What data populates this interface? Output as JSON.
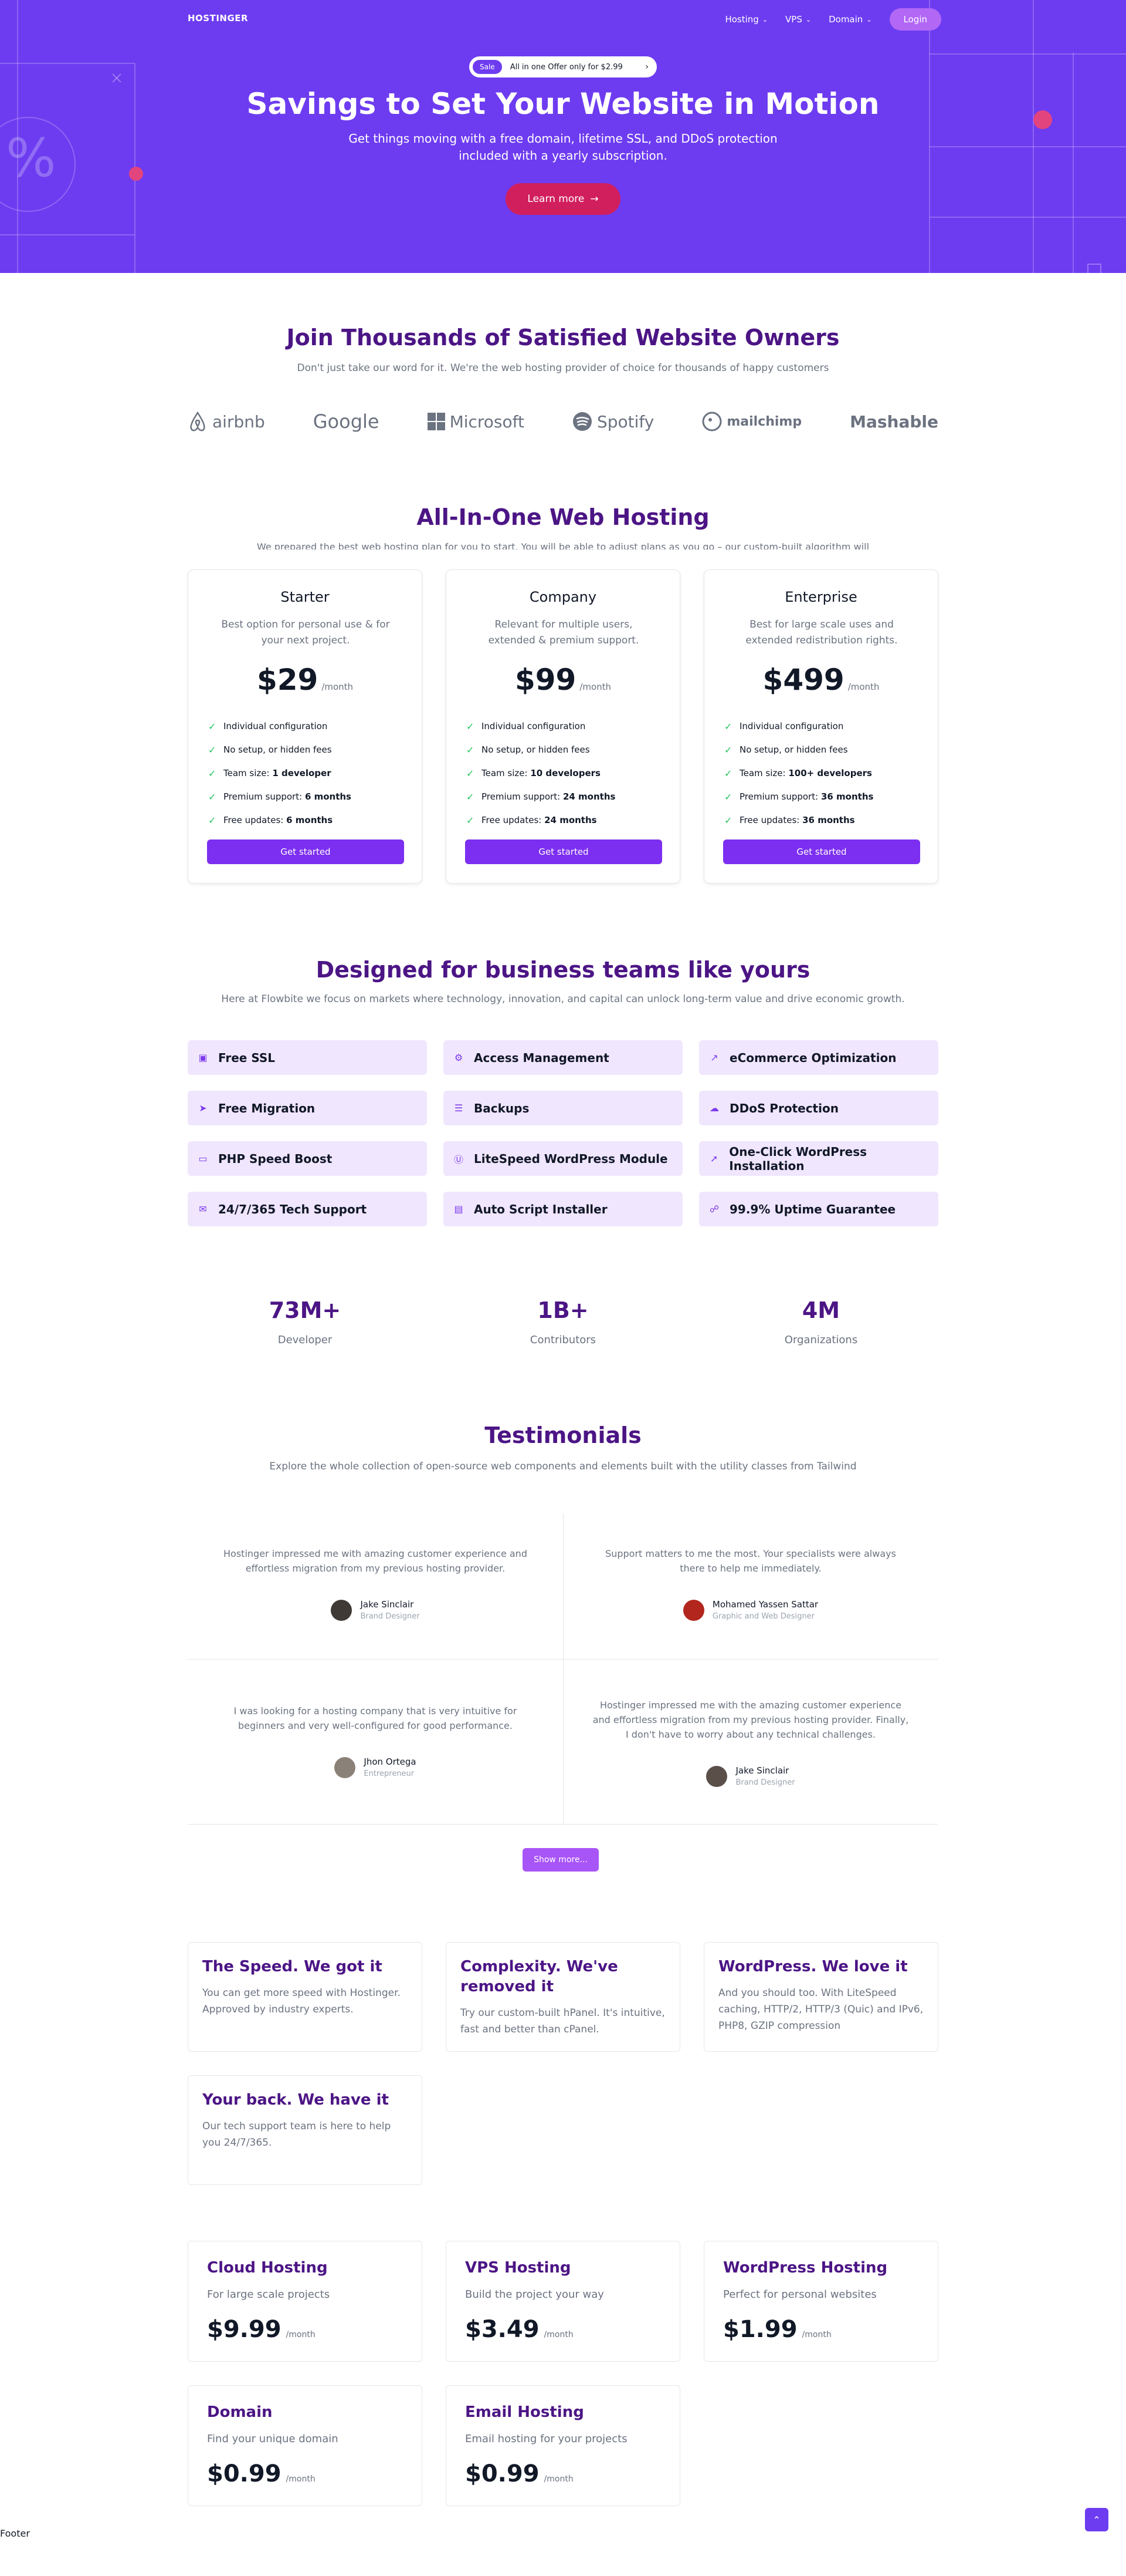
{
  "nav": {
    "logo": "HOSTINGER",
    "items": [
      {
        "label": "Hosting"
      },
      {
        "label": "VPS"
      },
      {
        "label": "Domain"
      }
    ],
    "login": "Login"
  },
  "hero": {
    "offer_badge": "Sale",
    "offer_text": "All in one Offer only for $2.99",
    "title": "Savings to Set Your Website in Motion",
    "subtitle": "Get things moving with a free domain, lifetime SSL, and DDoS protection included with a yearly subscription.",
    "cta": "Learn more",
    "colors": {
      "background": "#6d3cf0",
      "cta": "#d11f5e"
    }
  },
  "clients": {
    "title": "Join Thousands of Satisfied Website Owners",
    "subtitle": "Don't just take our word for it. We're the web hosting provider of choice for thousands of happy customers",
    "logos": [
      {
        "name": "airbnb",
        "icon": "airbnb-icon"
      },
      {
        "name": "Google",
        "icon": ""
      },
      {
        "name": "Microsoft",
        "icon": "microsoft-icon"
      },
      {
        "name": "Spotify",
        "icon": "spotify-icon"
      },
      {
        "name": "mailchimp",
        "icon": "mailchimp-icon"
      },
      {
        "name": "Mashable",
        "icon": ""
      }
    ]
  },
  "pricing": {
    "title": "All-In-One Web Hosting",
    "subtitle": "We prepared the best web hosting plan for you to start. You will be able to adjust plans as you go – our custom-built algorithm will",
    "plans": [
      {
        "name": "Starter",
        "description": "Best option for personal use & for your next project.",
        "price": "$29",
        "period": "/month",
        "features": [
          {
            "label": "Individual configuration",
            "value": ""
          },
          {
            "label": "No setup, or hidden fees",
            "value": ""
          },
          {
            "label": "Team size: ",
            "value": "1 developer"
          },
          {
            "label": "Premium support: ",
            "value": "6 months"
          },
          {
            "label": "Free updates: ",
            "value": "6 months"
          }
        ],
        "cta": "Get started"
      },
      {
        "name": "Company",
        "description": "Relevant for multiple users, extended & premium support.",
        "price": "$99",
        "period": "/month",
        "features": [
          {
            "label": "Individual configuration",
            "value": ""
          },
          {
            "label": "No setup, or hidden fees",
            "value": ""
          },
          {
            "label": "Team size: ",
            "value": "10 developers"
          },
          {
            "label": "Premium support: ",
            "value": "24 months"
          },
          {
            "label": "Free updates: ",
            "value": "24 months"
          }
        ],
        "cta": "Get started"
      },
      {
        "name": "Enterprise",
        "description": "Best for large scale uses and extended redistribution rights.",
        "price": "$499",
        "period": "/month",
        "features": [
          {
            "label": "Individual configuration",
            "value": ""
          },
          {
            "label": "No setup, or hidden fees",
            "value": ""
          },
          {
            "label": "Team size: ",
            "value": "100+ developers"
          },
          {
            "label": "Premium support: ",
            "value": "36 months"
          },
          {
            "label": "Free updates: ",
            "value": "36 months"
          }
        ],
        "cta": "Get started"
      }
    ]
  },
  "features": {
    "title": "Designed for business teams like yours",
    "subtitle": "Here at Flowbite we focus on markets where technology, innovation, and capital can unlock long-term value and drive economic growth.",
    "items": [
      {
        "label": "Free SSL",
        "icon": "ssl-icon"
      },
      {
        "label": "Access Management",
        "icon": "access-icon"
      },
      {
        "label": "eCommerce Optimization",
        "icon": "chart-icon"
      },
      {
        "label": "Free Migration",
        "icon": "rocket-icon"
      },
      {
        "label": "Backups",
        "icon": "list-icon"
      },
      {
        "label": "DDoS Protection",
        "icon": "cloud-icon"
      },
      {
        "label": "PHP Speed Boost",
        "icon": "php-icon"
      },
      {
        "label": "LiteSpeed WordPress Module",
        "icon": "wordpress-icon"
      },
      {
        "label": "One-Click WordPress Installation",
        "icon": "cursor-icon"
      },
      {
        "label": "24/7/365 Tech Support",
        "icon": "chat-icon"
      },
      {
        "label": "Auto Script Installer",
        "icon": "script-icon"
      },
      {
        "label": "99.9% Uptime Guarantee",
        "icon": "lock-icon"
      }
    ]
  },
  "stats": [
    {
      "value": "73M+",
      "label": "Developer"
    },
    {
      "value": "1B+",
      "label": "Contributors"
    },
    {
      "value": "4M",
      "label": "Organizations"
    }
  ],
  "testimonials": {
    "title": "Testimonials",
    "subtitle": "Explore the whole collection of open-source web components and elements built with the utility classes from Tailwind",
    "items": [
      {
        "quote": "Hostinger impressed me with amazing customer experience and effortless migration from my previous hosting provider.",
        "name": "Jake Sinclair",
        "role": "Brand Designer",
        "avatar_color": "#3f3a36"
      },
      {
        "quote": "Support matters to me the most. Your specialists were always there to help me immediately.",
        "name": "Mohamed Yassen Sattar",
        "role": "Graphic and Web Designer",
        "avatar_color": "#b3261e"
      },
      {
        "quote": "I was looking for a hosting company that is very intuitive for beginners and very well-configured for good performance.",
        "name": "Jhon Ortega",
        "role": "Entrepreneur",
        "avatar_color": "#8a8178"
      },
      {
        "quote": "Hostinger impressed me with the amazing customer experience and effortless migration from my previous hosting provider. Finally, I don't have to worry about any technical challenges.",
        "name": "Jake Sinclair",
        "role": "Brand Designer",
        "avatar_color": "#5a4f49"
      }
    ],
    "show_more": "Show more..."
  },
  "why": [
    {
      "title": "The Speed. We got it",
      "text": "You can get more speed with Hostinger. Approved by industry experts."
    },
    {
      "title": "Complexity. We've removed it",
      "text": "Try our custom-built hPanel. It's intuitive, fast and better than cPanel."
    },
    {
      "title": "WordPress. We love it",
      "text": "And you should too. With LiteSpeed caching, HTTP/2, HTTP/3 (Quic) and IPv6, PHP8, GZIP compression"
    },
    {
      "title": "Your back. We have it",
      "text": "Our tech support team is here to help you 24/7/365."
    }
  ],
  "hosting": [
    {
      "title": "Cloud Hosting",
      "desc": "For large scale projects",
      "price": "$9.99",
      "period": "/month"
    },
    {
      "title": "VPS Hosting",
      "desc": "Build the project your way",
      "price": "$3.49",
      "period": "/month"
    },
    {
      "title": "WordPress Hosting",
      "desc": "Perfect for personal websites",
      "price": "$1.99",
      "period": "/month"
    },
    {
      "title": "Domain",
      "desc": "Find your unique domain",
      "price": "$0.99",
      "period": "/month"
    },
    {
      "title": "Email Hosting",
      "desc": "Email hosting for your projects",
      "price": "$0.99",
      "period": "/month"
    }
  ],
  "footer": {
    "text": "Footer"
  },
  "scroll_top": {
    "icon": "chevron-up-icon"
  }
}
